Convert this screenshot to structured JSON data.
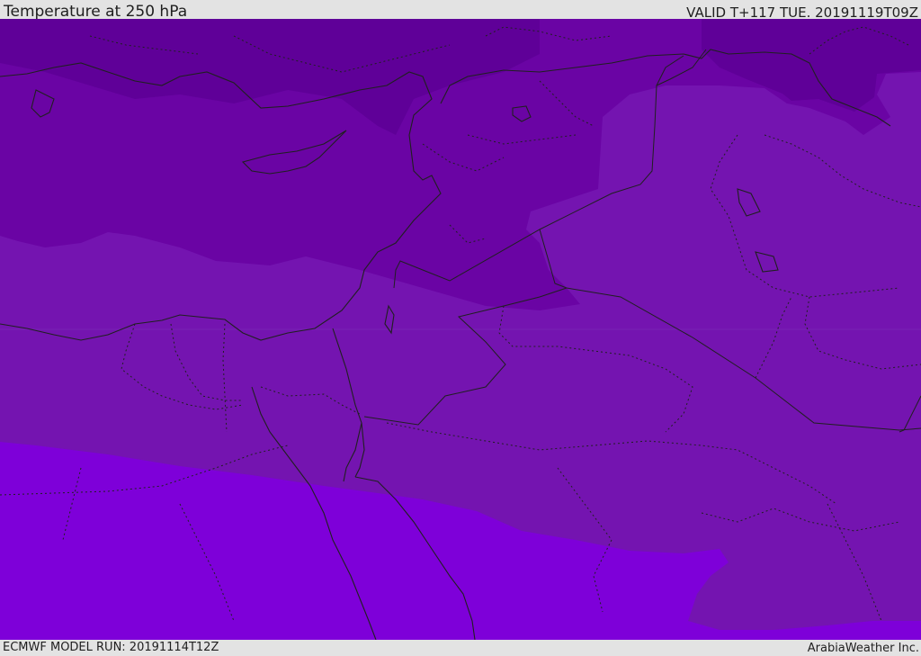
{
  "header": {
    "title": "Temperature at 250 hPa",
    "valid": "VALID T+117 TUE. 20191119T09Z"
  },
  "footer": {
    "model_run": "ECMWF MODEL RUN: 20191114T12Z",
    "credit": "ArabiaWeather Inc."
  },
  "colors": {
    "coldest_band": "#5f0098",
    "cold_band": "#6a04a4",
    "mid_band": "#7414b0",
    "warm_band": "#7e00d9",
    "boundary_lines": "#202020",
    "bars": "#e3e3e3"
  }
}
